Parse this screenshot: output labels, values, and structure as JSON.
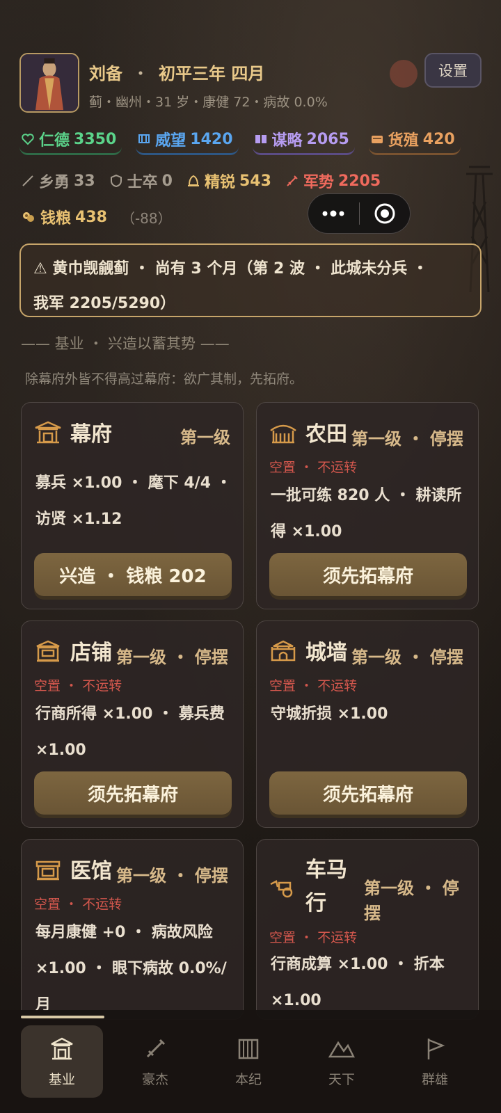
{
  "player": {
    "name": "刘备",
    "date": "初平三年 四月",
    "details": "蓟・幽州・31 岁・康健 72・病故 0.0%",
    "settings_label": "设置"
  },
  "attributes": [
    {
      "label": "仁德",
      "value": "3350",
      "color": "#5bd38a",
      "icon": "heart-icon"
    },
    {
      "label": "威望",
      "value": "1420",
      "color": "#5aa6f0",
      "icon": "banner-icon"
    },
    {
      "label": "谋略",
      "value": "2065",
      "color": "#b69cf0",
      "icon": "book-icon"
    },
    {
      "label": "货殖",
      "value": "420",
      "color": "#e9a160",
      "icon": "ingot-icon"
    }
  ],
  "troops": [
    {
      "label": "乡勇",
      "value": "33",
      "icon": "spear-icon"
    },
    {
      "label": "士卒",
      "value": "0",
      "icon": "shield-icon"
    },
    {
      "label": "精锐",
      "value": "543",
      "icon": "helmet-icon"
    },
    {
      "label": "军势",
      "value": "2205",
      "icon": "sword-icon"
    }
  ],
  "grain": {
    "label": "钱粮",
    "value": "438",
    "delta": "（-88）"
  },
  "alert": {
    "line1": "⚠ 黄巾觊觎蓟 ・ 尚有 3 个月（第 2 波 ・ 此城未分兵 ・",
    "line2": "我军 2205/5290）"
  },
  "section": {
    "title": "—— 基业 ・ 兴造以蓄其势 ——",
    "desc": "除幕府外皆不得高过幕府：欲广其制，先拓府。"
  },
  "buildings": [
    {
      "name": "幕府",
      "level": "第一级",
      "status": "",
      "desc": "募兵 ×1.00 ・ 麾下 4/4 ・ 访贤 ×1.12",
      "button": "兴造 ・ 钱粮 202"
    },
    {
      "name": "农田",
      "level": "第一级 ・ 停摆",
      "status": "空置 ・ 不运转",
      "desc": "一批可练 820 人 ・ 耕读所得 ×1.00",
      "button": "须先拓幕府"
    },
    {
      "name": "店铺",
      "level": "第一级 ・ 停摆",
      "status": "空置 ・ 不运转",
      "desc": "行商所得 ×1.00 ・ 募兵费 ×1.00",
      "button": "须先拓幕府"
    },
    {
      "name": "城墙",
      "level": "第一级 ・ 停摆",
      "status": "空置 ・ 不运转",
      "desc": "守城折损 ×1.00",
      "button": "须先拓幕府"
    },
    {
      "name": "医馆",
      "level": "第一级 ・ 停摆",
      "status": "空置 ・ 不运转",
      "desc": "每月康健 +0 ・ 病故风险 ×1.00 ・ 眼下病故 0.0%/月",
      "button": ""
    },
    {
      "name": "车马行",
      "level": "第一级 ・ 停摆",
      "status": "空置 ・ 不运转",
      "desc": "行商成算 ×1.00 ・ 折本 ×1.00",
      "button": ""
    }
  ],
  "nav": [
    {
      "label": "基业",
      "active": true,
      "icon": "palace-icon"
    },
    {
      "label": "豪杰",
      "active": false,
      "icon": "sword-icon"
    },
    {
      "label": "本纪",
      "active": false,
      "icon": "scroll-icon"
    },
    {
      "label": "天下",
      "active": false,
      "icon": "mountain-icon"
    },
    {
      "label": "群雄",
      "active": false,
      "icon": "flag-icon"
    }
  ]
}
